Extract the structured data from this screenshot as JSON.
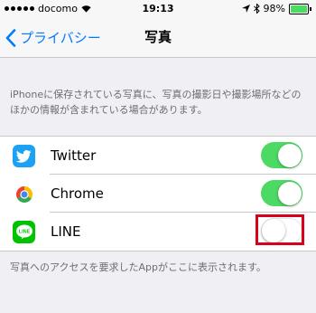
{
  "status_bar": {
    "carrier": "docomo",
    "time": "19:13",
    "battery": "98%",
    "battery_level": 0.98
  },
  "nav": {
    "back_label": "プライバシー",
    "title": "写真"
  },
  "description": "iPhoneに保存されている写真に、写真の撮影日や撮影場所などのほかの情報が含まれている場合があります。",
  "apps": [
    {
      "name": "Twitter",
      "enabled": true
    },
    {
      "name": "Chrome",
      "enabled": true
    },
    {
      "name": "LINE",
      "enabled": false,
      "icon_text": "LINE"
    }
  ],
  "footer": "写真へのアクセスを要求したAppがここに表示されます。",
  "colors": {
    "accent": "#007aff",
    "toggle_on": "#4cd964",
    "highlight": "#d9001b"
  }
}
